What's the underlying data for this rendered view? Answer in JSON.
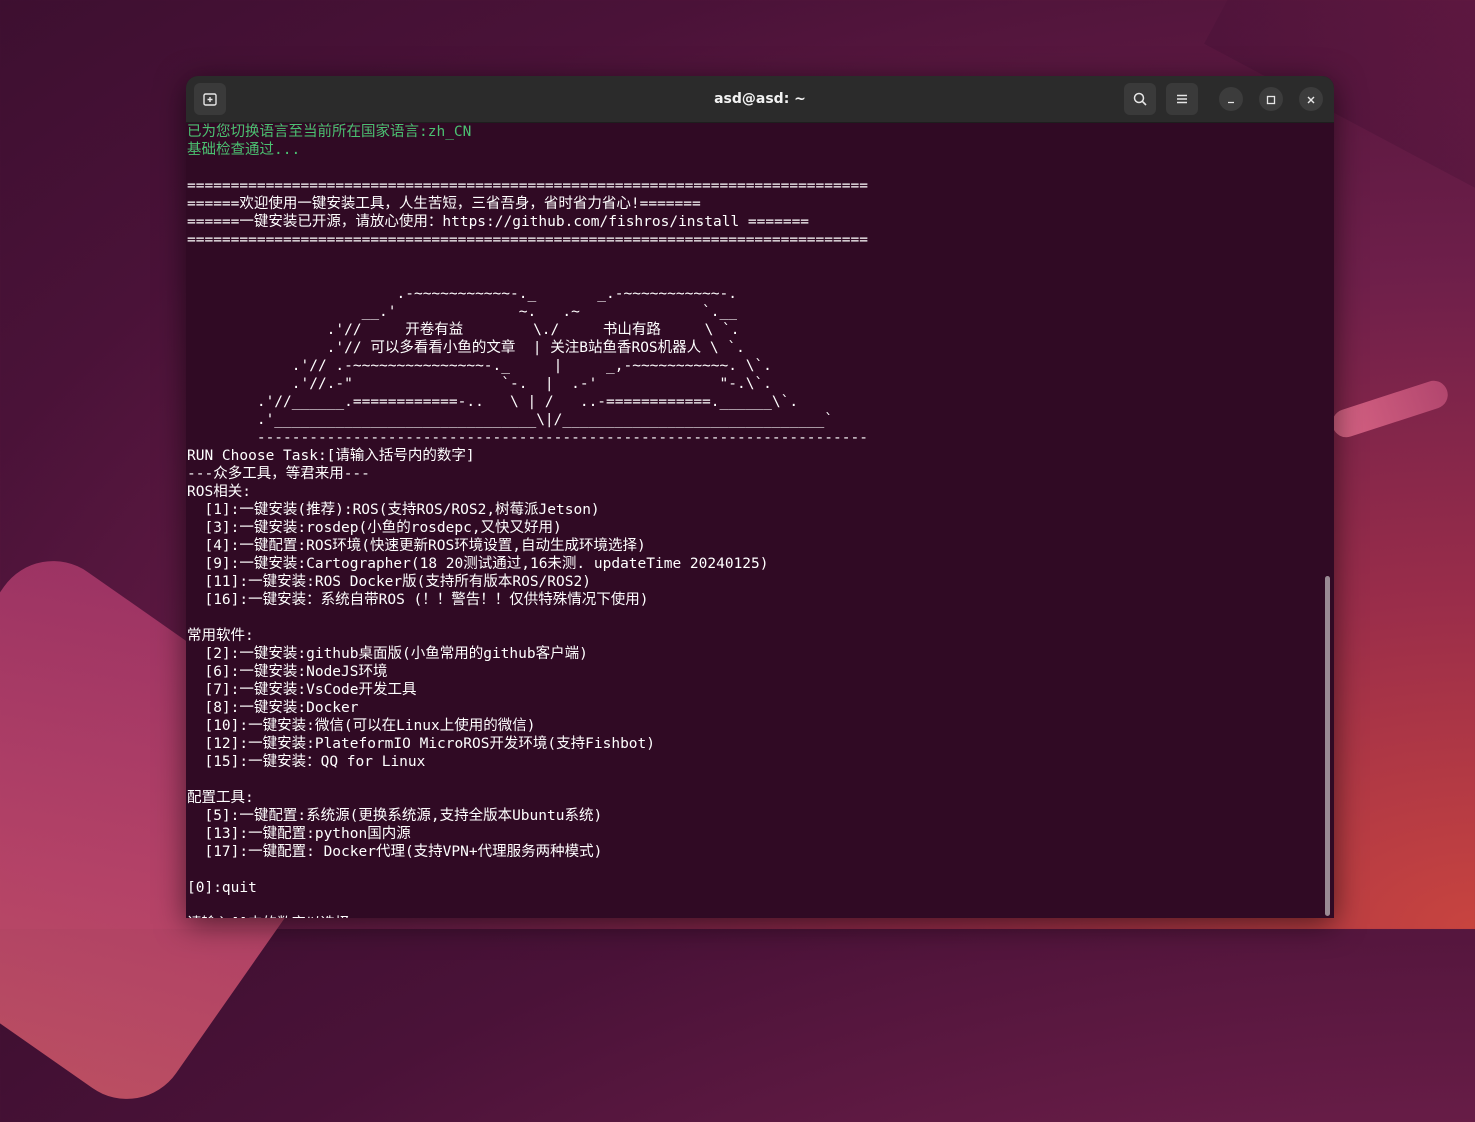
{
  "window": {
    "title": "asd@asd: ~"
  },
  "terminal": {
    "lines": [
      {
        "text": "已为您切换语言至当前所在国家语言:zh_CN",
        "color": "green"
      },
      {
        "text": "基础检查通过...",
        "color": "green"
      },
      {
        "text": "",
        "color": ""
      },
      {
        "text": "==============================================================================",
        "color": ""
      },
      {
        "text": "======欢迎使用一键安装工具，人生苦短，三省吾身，省时省力省心!=======",
        "color": ""
      },
      {
        "text": "======一键安装已开源，请放心使用：https://github.com/fishros/install =======",
        "color": ""
      },
      {
        "text": "==============================================================================",
        "color": ""
      },
      {
        "text": "",
        "color": ""
      },
      {
        "text": "",
        "color": ""
      },
      {
        "text": "                        .-~~~~~~~~~~~-._       _.-~~~~~~~~~~~-.",
        "color": ""
      },
      {
        "text": "                    __.'              ~.   .~              `.__",
        "color": ""
      },
      {
        "text": "                .'//     开卷有益        \\./     书山有路     \\ `.",
        "color": ""
      },
      {
        "text": "                .'// 可以多看看小鱼的文章  | 关注B站鱼香ROS机器人 \\ `.",
        "color": ""
      },
      {
        "text": "            .'// .-~~~~~~~~~~~~~~~-._     |     _,-~~~~~~~~~~~. \\`.",
        "color": ""
      },
      {
        "text": "            .'//.-\"                 `-.  |  .-'              \"-.\\`.",
        "color": ""
      },
      {
        "text": "        .'//______.============-..   \\ | /   ..-============.______\\`.",
        "color": ""
      },
      {
        "text": "        .'______________________________\\|/______________________________`",
        "color": ""
      },
      {
        "text": "        ----------------------------------------------------------------------",
        "color": ""
      },
      {
        "text": "RUN Choose Task:[请输入括号内的数字]",
        "color": ""
      },
      {
        "text": "---众多工具，等君来用---",
        "color": ""
      },
      {
        "text": "ROS相关:",
        "color": ""
      },
      {
        "text": "  [1]:一键安装(推荐):ROS(支持ROS/ROS2,树莓派Jetson)",
        "color": ""
      },
      {
        "text": "  [3]:一键安装:rosdep(小鱼的rosdepc,又快又好用)",
        "color": ""
      },
      {
        "text": "  [4]:一键配置:ROS环境(快速更新ROS环境设置,自动生成环境选择)",
        "color": ""
      },
      {
        "text": "  [9]:一键安装:Cartographer(18 20测试通过,16未测. updateTime 20240125)",
        "color": ""
      },
      {
        "text": "  [11]:一键安装:ROS Docker版(支持所有版本ROS/ROS2)",
        "color": ""
      },
      {
        "text": "  [16]:一键安装：系统自带ROS (！！警告！！仅供特殊情况下使用)",
        "color": ""
      },
      {
        "text": "",
        "color": ""
      },
      {
        "text": "常用软件:",
        "color": ""
      },
      {
        "text": "  [2]:一键安装:github桌面版(小鱼常用的github客户端)",
        "color": ""
      },
      {
        "text": "  [6]:一键安装:NodeJS环境",
        "color": ""
      },
      {
        "text": "  [7]:一键安装:VsCode开发工具",
        "color": ""
      },
      {
        "text": "  [8]:一键安装:Docker",
        "color": ""
      },
      {
        "text": "  [10]:一键安装:微信(可以在Linux上使用的微信)",
        "color": ""
      },
      {
        "text": "  [12]:一键安装:PlateformIO MicroROS开发环境(支持Fishbot)",
        "color": ""
      },
      {
        "text": "  [15]:一键安装：QQ for Linux",
        "color": ""
      },
      {
        "text": "",
        "color": ""
      },
      {
        "text": "配置工具:",
        "color": ""
      },
      {
        "text": "  [5]:一键配置:系统源(更换系统源,支持全版本Ubuntu系统)",
        "color": ""
      },
      {
        "text": "  [13]:一键配置:python国内源",
        "color": ""
      },
      {
        "text": "  [17]:一键配置: Docker代理(支持VPN+代理服务两种模式)",
        "color": ""
      },
      {
        "text": "",
        "color": ""
      },
      {
        "text": "[0]:quit",
        "color": ""
      },
      {
        "text": "",
        "color": ""
      },
      {
        "text": "请输入[]内的数字以选择:",
        "color": ""
      }
    ]
  },
  "icons": {
    "new_tab": "new-tab-icon",
    "search": "search-icon",
    "menu": "hamburger-menu-icon",
    "minimize": "minimize-icon",
    "maximize": "maximize-icon",
    "close": "close-icon"
  },
  "colors": {
    "terminal_bg": "#300a24",
    "text_green": "#4bc071",
    "titlebar_bg": "#2b2b2b"
  }
}
